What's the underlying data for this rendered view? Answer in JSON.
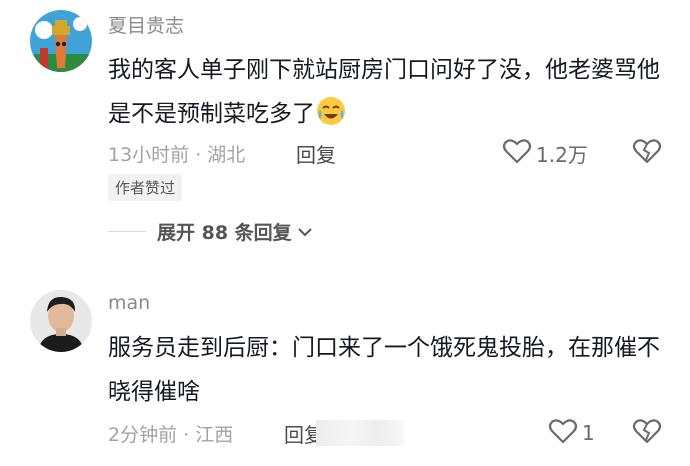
{
  "comments": [
    {
      "username": "夏目贵志",
      "text": "我的客人单子刚下就站厨房门口问好了没，他老婆骂他是不是预制菜吃多了",
      "emoji": "crying-laughing-emoji",
      "meta": "13小时前 · 湖北",
      "reply_label": "回复",
      "like_count": "1.2万",
      "badge": "作者赞过",
      "expand_label": "展开 88 条回复"
    },
    {
      "username": "man",
      "text": "服务员走到后厨：门口来了一个饿死鬼投胎，在那催不晓得催啥",
      "meta": "2分钟前 · 江西",
      "reply_label": "回复",
      "like_count": "1"
    }
  ],
  "colors": {
    "username": "#8a8a8a",
    "text": "#161823",
    "meta": "#a3a3a3",
    "badge_bg": "#f2f2f2"
  }
}
